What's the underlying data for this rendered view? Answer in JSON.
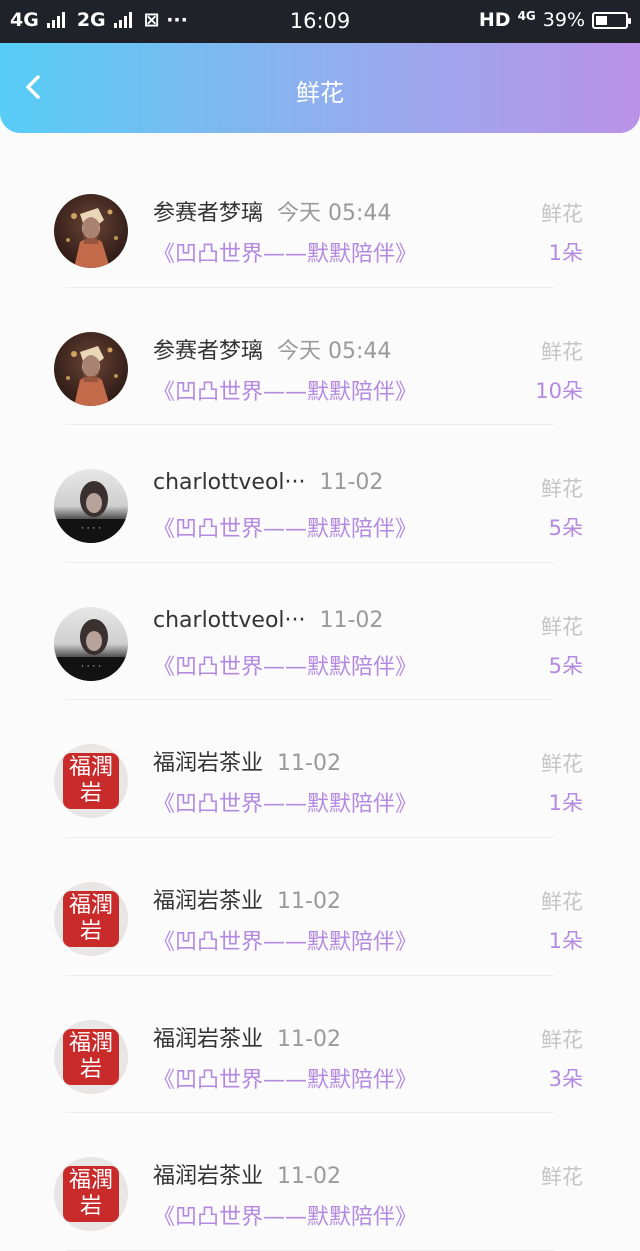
{
  "status_bar": {
    "left": "4G",
    "left2": "2G",
    "time": "16:09",
    "hd": "HD",
    "net": "4G",
    "battery": "39%",
    "battery_level": 0.39
  },
  "header": {
    "title": "鲜花"
  },
  "rows": [
    {
      "avatar": "avatar-illustration",
      "name": "参赛者梦璃",
      "time": "今天 05:44",
      "gift": "《凹凸世界——默默陪伴》",
      "type": "鲜花",
      "count": "1朵"
    },
    {
      "avatar": "avatar-illustration",
      "name": "参赛者梦璃",
      "time": "今天 05:44",
      "gift": "《凹凸世界——默默陪伴》",
      "type": "鲜花",
      "count": "10朵"
    },
    {
      "avatar": "avatar-photo",
      "name": "charlottveol···",
      "time": "11-02",
      "gift": "《凹凸世界——默默陪伴》",
      "type": "鲜花",
      "count": "5朵"
    },
    {
      "avatar": "avatar-photo",
      "name": "charlottveol···",
      "time": "11-02",
      "gift": "《凹凸世界——默默陪伴》",
      "type": "鲜花",
      "count": "5朵"
    },
    {
      "avatar": "avatar-seal",
      "name": "福润岩茶业",
      "time": "11-02",
      "gift": "《凹凸世界——默默陪伴》",
      "type": "鲜花",
      "count": "1朵"
    },
    {
      "avatar": "avatar-seal",
      "name": "福润岩茶业",
      "time": "11-02",
      "gift": "《凹凸世界——默默陪伴》",
      "type": "鲜花",
      "count": "1朵"
    },
    {
      "avatar": "avatar-seal",
      "name": "福润岩茶业",
      "time": "11-02",
      "gift": "《凹凸世界——默默陪伴》",
      "type": "鲜花",
      "count": "3朵"
    },
    {
      "avatar": "avatar-seal",
      "name": "福润岩茶业",
      "time": "11-02",
      "gift": "《凹凸世界——默默陪伴》",
      "type": "鲜花",
      "count": ""
    }
  ],
  "colors": {
    "accent": "#b48ae0",
    "header_start": "#56cdf6",
    "header_end": "#bb92e8"
  }
}
